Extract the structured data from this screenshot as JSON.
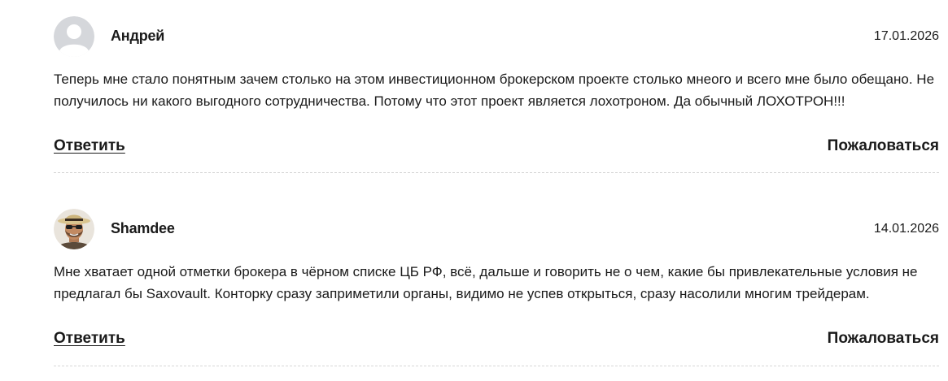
{
  "comments": [
    {
      "author": "Андрей",
      "date": "17.01.2026",
      "avatar": "default-user-icon",
      "text": "Теперь мне стало понятным зачем столько на этом инвестиционном брокерском проекте столько мнеого и всего мне было обещано. Не получилось ни какого выгодного сотрудничества. Потому что этот проект является лохотроном. Да обычный ЛОХОТРОН!!!",
      "reply_label": "Ответить",
      "complain_label": "Пожаловаться"
    },
    {
      "author": "Shamdee",
      "date": "14.01.2026",
      "avatar": "user-photo",
      "text": "Мне хватает одной отметки брокера в чёрном списке ЦБ РФ, всё, дальше и говорить не о чем, какие бы привлекательные условия не предлагал бы Saxovault. Конторку сразу заприметили органы, видимо не успев открыться, сразу насолили многим трейдерам.",
      "reply_label": "Ответить",
      "complain_label": "Пожаловаться"
    }
  ],
  "colors": {
    "text": "#1a1a1a",
    "avatar_bg": "#d5d7db",
    "avatar_fg": "#ffffff",
    "separator": "#d6d6d6"
  }
}
